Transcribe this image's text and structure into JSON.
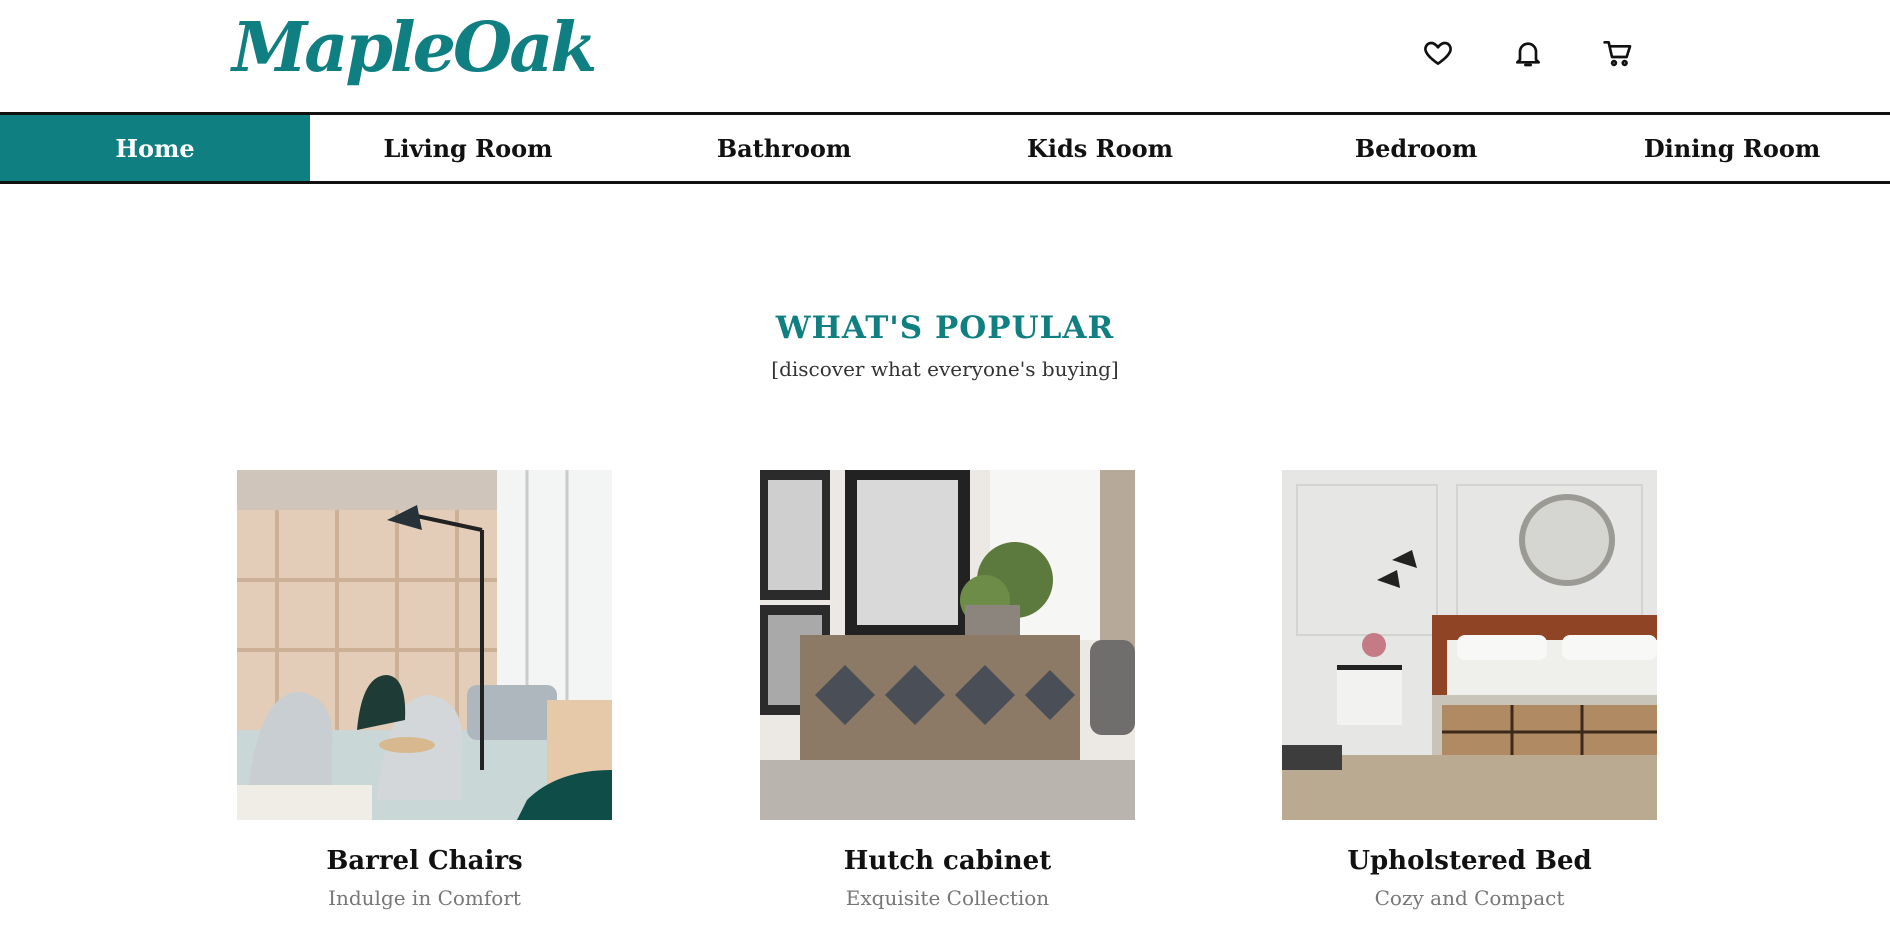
{
  "brand": {
    "logo_text": "MapleOak",
    "accent_color": "#0f7f82"
  },
  "header_icons": [
    {
      "name": "heart-icon"
    },
    {
      "name": "bell-icon"
    },
    {
      "name": "cart-icon"
    }
  ],
  "nav": {
    "items": [
      {
        "label": "Home",
        "active": true
      },
      {
        "label": "Living Room",
        "active": false
      },
      {
        "label": "Bathroom",
        "active": false
      },
      {
        "label": "Kids Room",
        "active": false
      },
      {
        "label": "Bedroom",
        "active": false
      },
      {
        "label": "Dining Room",
        "active": false
      }
    ]
  },
  "popular": {
    "title": "WHAT'S POPULAR",
    "subtitle": "[discover what everyone's buying]",
    "products": [
      {
        "title": "Barrel Chairs",
        "subtitle": "Indulge in Comfort"
      },
      {
        "title": "Hutch cabinet",
        "subtitle": "Exquisite Collection"
      },
      {
        "title": "Upholstered Bed",
        "subtitle": "Cozy and Compact"
      }
    ]
  }
}
